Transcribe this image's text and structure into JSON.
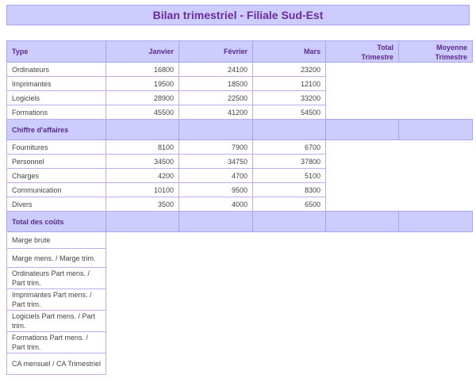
{
  "title": "Bilan trimestriel - Filiale Sud-Est",
  "header": {
    "type": "Type",
    "janvier": "Janvier",
    "fevrier": "Février",
    "mars": "Mars",
    "total_line1": "Total",
    "total_line2": "Trimestre",
    "moyenne_line1": "Moyenne",
    "moyenne_line2": "Trimestre"
  },
  "revenue_rows": [
    {
      "label": "Ordinateurs",
      "jan": "16800",
      "feb": "24100",
      "mar": "23200"
    },
    {
      "label": "Imprimantes",
      "jan": "19500",
      "feb": "18500",
      "mar": "12100"
    },
    {
      "label": "Logiciels",
      "jan": "28900",
      "feb": "22500",
      "mar": "33200"
    },
    {
      "label": "Formations",
      "jan": "45500",
      "feb": "41200",
      "mar": "54500"
    }
  ],
  "revenue_total_label": "Chiffre d'affaires",
  "cost_rows": [
    {
      "label": "Fournitures",
      "jan": "8100",
      "feb": "7900",
      "mar": "6700"
    },
    {
      "label": "Personnel",
      "jan": "34500",
      "feb": "34750",
      "mar": "37800"
    },
    {
      "label": "Charges",
      "jan": "4200",
      "feb": "4700",
      "mar": "5100"
    },
    {
      "label": "Communication",
      "jan": "10100",
      "feb": "9500",
      "mar": "8300"
    },
    {
      "label": "Divers",
      "jan": "3500",
      "feb": "4000",
      "mar": "6500"
    }
  ],
  "cost_total_label": "Total des coûts",
  "indicators": {
    "marge_brute": "Marge brute",
    "marge_ratio": "Marge mens. / Marge trim.",
    "ordinateurs_part": "Ordinateurs Part mens. / Part trim.",
    "imprimantes_part": "Imprimantes Part mens. / Part trim.",
    "logiciels_part": "Logiciels Part mens. / Part trim.",
    "formations_part": "Formations Part mens. / Part trim.",
    "ca_ratio": "CA mensuel / CA Trimestriel"
  },
  "colors": {
    "header_fill": "#ccccff",
    "header_text": "#5a2a8a",
    "title_text": "#6c2c9c",
    "grid_border": "#c6a8ec"
  }
}
